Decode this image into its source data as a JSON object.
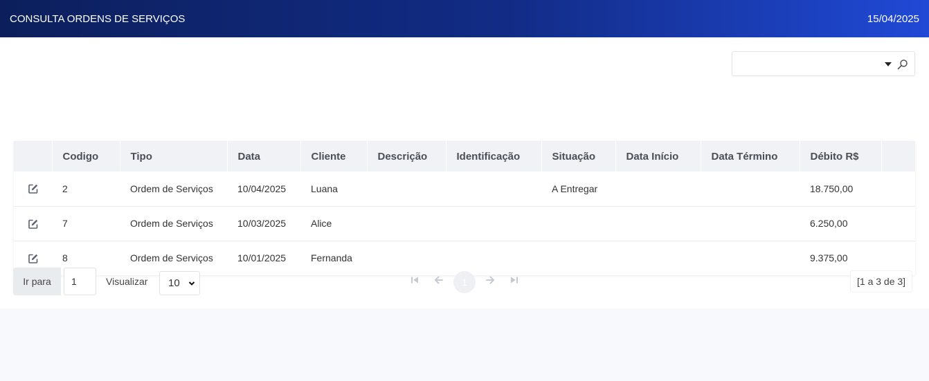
{
  "header": {
    "title": "CONSULTA ORDENS DE SERVIÇOS",
    "date": "15/04/2025"
  },
  "search": {
    "value": "",
    "placeholder": "",
    "icons": [
      "caret-down-icon",
      "search-icon"
    ]
  },
  "table": {
    "columns": [
      "",
      "Codigo",
      "Tipo",
      "Data",
      "Cliente",
      "Descrição",
      "Identificação",
      "Situação",
      "Data Início",
      "Data Término",
      "Débito R$",
      ""
    ],
    "rows": [
      {
        "codigo": "2",
        "tipo": "Ordem de Serviços",
        "data": "10/04/2025",
        "cliente": "Luana",
        "descricao": "",
        "identificacao": "",
        "situacao": "A Entregar",
        "data_inicio": "",
        "data_termino": "",
        "debito": "18.750,00"
      },
      {
        "codigo": "7",
        "tipo": "Ordem de Serviços",
        "data": "10/03/2025",
        "cliente": "Alice",
        "descricao": "",
        "identificacao": "",
        "situacao": "",
        "data_inicio": "",
        "data_termino": "",
        "debito": "6.250,00"
      },
      {
        "codigo": "8",
        "tipo": "Ordem de Serviços",
        "data": "10/01/2025",
        "cliente": "Fernanda",
        "descricao": "",
        "identificacao": "",
        "situacao": "",
        "data_inicio": "",
        "data_termino": "",
        "debito": "9.375,00"
      }
    ],
    "row_action_icon": "edit-icon"
  },
  "pager": {
    "goto_label": "Ir para",
    "goto_value": "1",
    "view_label": "Visualizar",
    "view_value": "10",
    "current_page": "1",
    "info": "[1 a 3 de 3]",
    "icons": [
      "first-page-icon",
      "prev-page-icon",
      "next-page-icon",
      "last-page-icon"
    ]
  },
  "colors": {
    "header_start": "#0c1f5c",
    "header_end": "#2049d6",
    "table_header_bg": "#f0f2f5",
    "page_bg": "#f8f9fc"
  }
}
